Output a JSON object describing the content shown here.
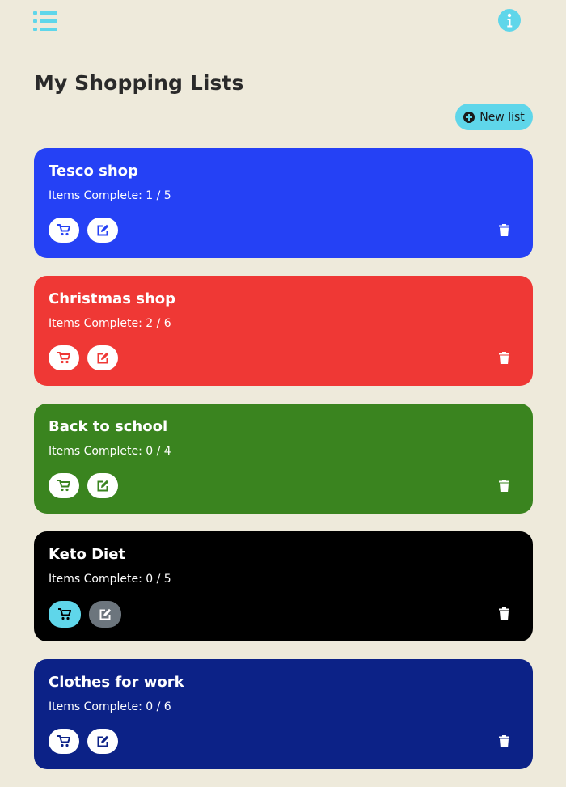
{
  "header": {
    "menu_icon": "list-icon",
    "info_icon": "info-circle-icon",
    "accent_color": "#5fd6ea"
  },
  "page": {
    "title": "My Shopping Lists",
    "background": "#eeeadb"
  },
  "actions": {
    "new_list_label": "New list",
    "new_list_icon": "plus-circle-icon"
  },
  "lists": [
    {
      "name": "Tesco shop",
      "progress": "Items Complete: 1 / 5",
      "complete": 1,
      "total": 5,
      "color": "#2541f5",
      "shop_icon": "cart-icon",
      "edit_icon": "edit-icon",
      "delete_icon": "trash-icon"
    },
    {
      "name": "Christmas shop",
      "progress": "Items Complete: 2 / 6",
      "complete": 2,
      "total": 6,
      "color": "#ef3835",
      "shop_icon": "cart-icon",
      "edit_icon": "edit-icon",
      "delete_icon": "trash-icon"
    },
    {
      "name": "Back to school",
      "progress": "Items Complete: 0 / 4",
      "complete": 0,
      "total": 4,
      "color": "#3a841f",
      "shop_icon": "cart-icon",
      "edit_icon": "edit-icon",
      "delete_icon": "trash-icon"
    },
    {
      "name": "Keto Diet",
      "progress": "Items Complete: 0 / 5",
      "complete": 0,
      "total": 5,
      "color": "#000000",
      "shop_icon": "cart-icon",
      "edit_icon": "edit-icon",
      "delete_icon": "trash-icon"
    },
    {
      "name": "Clothes for work",
      "progress": "Items Complete: 0 / 6",
      "complete": 0,
      "total": 6,
      "color": "#0c2287",
      "shop_icon": "cart-icon",
      "edit_icon": "edit-icon",
      "delete_icon": "trash-icon"
    }
  ]
}
